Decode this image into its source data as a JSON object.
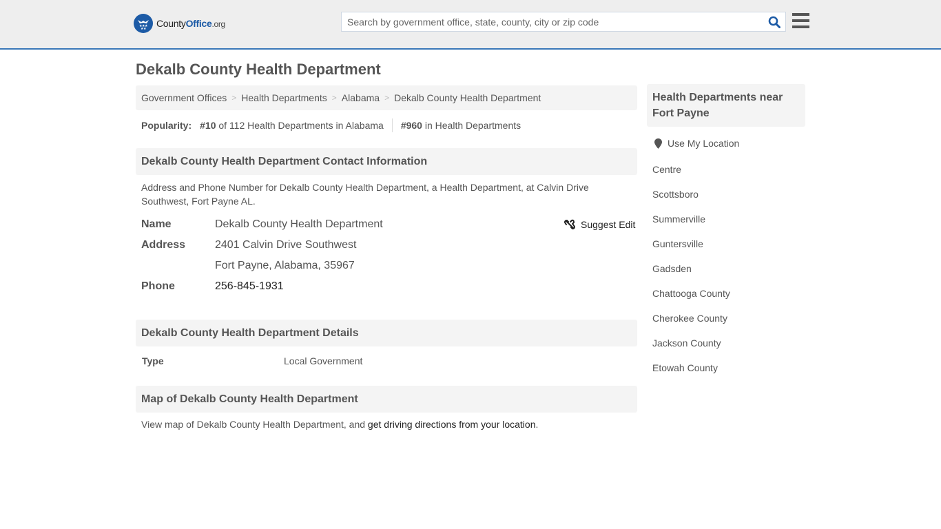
{
  "header": {
    "logo": {
      "part1": "County",
      "part2": "Office",
      "part3": ".org",
      "icon": "eagle-stars-badge-icon"
    },
    "search": {
      "placeholder": "Search by government office, state, county, city or zip code",
      "value": "",
      "icon": "search-icon"
    },
    "menu_icon": "hamburger-menu-icon",
    "colors": {
      "brand": "#1d5ba6",
      "accent_line": "#3a78b8"
    }
  },
  "page": {
    "title": "Dekalb County Health Department"
  },
  "breadcrumb": [
    {
      "label": "Government Offices"
    },
    {
      "label": "Health Departments"
    },
    {
      "label": "Alabama"
    },
    {
      "label": "Dekalb County Health Department"
    }
  ],
  "breadcrumb_sep": ">",
  "popularity": {
    "label": "Popularity:",
    "state_rank": "#10",
    "state_rank_text": " of 112 Health Departments in Alabama",
    "national_rank": "#960",
    "national_rank_text": " in Health Departments"
  },
  "contact": {
    "heading": "Dekalb County Health Department Contact Information",
    "description": "Address and Phone Number for Dekalb County Health Department, a Health Department, at Calvin Drive Southwest, Fort Payne AL.",
    "name_label": "Name",
    "name_value": "Dekalb County Health Department",
    "address_label": "Address",
    "address_line1": "2401 Calvin Drive Southwest",
    "address_line2": "Fort Payne, Alabama, 35967",
    "phone_label": "Phone",
    "phone_value": "256-845-1931",
    "suggest_edit": "Suggest Edit",
    "suggest_edit_icon": "unlink-icon"
  },
  "details": {
    "heading": "Dekalb County Health Department Details",
    "type_label": "Type",
    "type_value": "Local Government"
  },
  "map": {
    "heading": "Map of Dekalb County Health Department",
    "text_before": "View map of Dekalb County Health Department, and ",
    "link": "get driving directions from your location",
    "text_after": "."
  },
  "sidebar": {
    "heading": "Health Departments near Fort Payne",
    "use_location": "Use My Location",
    "location_icon": "map-pin-icon",
    "nearby": [
      "Centre",
      "Scottsboro",
      "Summerville",
      "Guntersville",
      "Gadsden",
      "Chattooga County",
      "Cherokee County",
      "Jackson County",
      "Etowah County"
    ]
  }
}
